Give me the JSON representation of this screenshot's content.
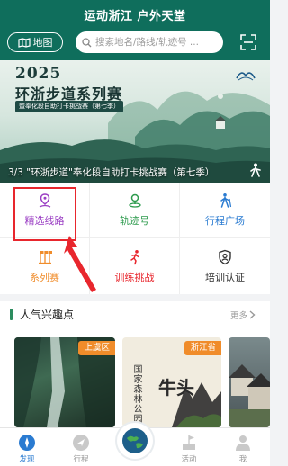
{
  "header": {
    "title": "运动浙江 户外天堂",
    "map_label": "地图",
    "search_placeholder": "搜索地名/路线/轨迹号 ..."
  },
  "banner": {
    "year": "2025",
    "series": "环浙步道系列赛",
    "subtitle": "暨奉化段自助打卡挑战赛（第七季）",
    "caption": "3/3 \"环浙步道\"奉化段自助打卡挑战赛（第七季）"
  },
  "grid": [
    {
      "label": "精选线路",
      "icon": "route-pin-icon",
      "color": "#9b3fc4"
    },
    {
      "label": "轨迹号",
      "icon": "location-track-icon",
      "color": "#2e9b4e"
    },
    {
      "label": "行程广场",
      "icon": "hiker-icon",
      "color": "#2a7bd1"
    },
    {
      "label": "系列赛",
      "icon": "race-flags-icon",
      "color": "#f08c2a"
    },
    {
      "label": "训练挑战",
      "icon": "runner-icon",
      "color": "#e8262d"
    },
    {
      "label": "培训认证",
      "icon": "certificate-icon",
      "color": "#333333"
    }
  ],
  "interests": {
    "title": "人气兴趣点",
    "more": "更多",
    "cards": [
      {
        "tag": "上虞区"
      },
      {
        "tag": "浙江省",
        "vertical_title": "国家森林公园",
        "big_text": "牛头"
      },
      {}
    ]
  },
  "nav": [
    {
      "label": "发现",
      "active": true
    },
    {
      "label": "行程",
      "active": false
    },
    {
      "label": "",
      "active": false
    },
    {
      "label": "活动",
      "active": false
    },
    {
      "label": "我",
      "active": false
    }
  ],
  "colors": {
    "header_bg": "#0f6e5c",
    "accent_blue": "#2a7bd1",
    "highlight_red": "#e8262d",
    "tag_orange": "#f08c2a"
  }
}
